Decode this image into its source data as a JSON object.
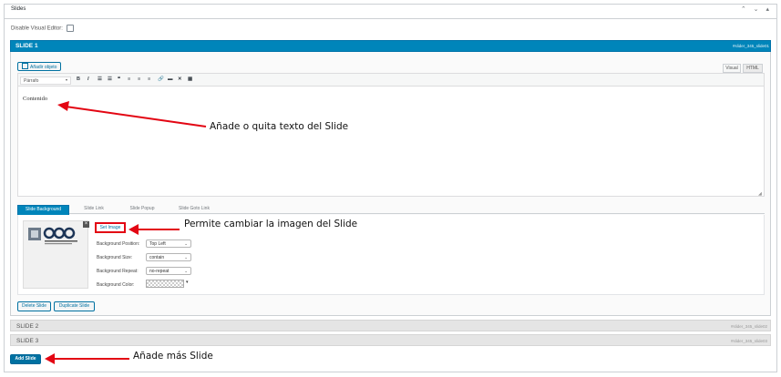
{
  "panel": {
    "title": "Slides",
    "arrows": "⌃ ⌄ ▴"
  },
  "disable_visual_editor": {
    "label": "Disable Visual Editor:"
  },
  "slide1": {
    "title": "SLIDE 1",
    "id": "#slider_345_slide01",
    "media_button": "Añadir objeto",
    "editor_tabs": [
      "Visual",
      "HTML"
    ],
    "format_select": "Párrafo",
    "toolbar_icons": [
      "bold-icon",
      "italic-icon",
      "bullet-list-icon",
      "numbered-list-icon",
      "blockquote-icon",
      "align-left-icon",
      "align-center-icon",
      "align-right-icon",
      "link-icon",
      "more-tag-icon",
      "fullscreen-icon",
      "toolbar-toggle-icon"
    ],
    "content": "Contenido",
    "bg_tabs": [
      "Slide Background",
      "Slide Link",
      "Slide Popup",
      "Slide Goto Link"
    ],
    "set_image": "Set Image",
    "thumbnail_text": "Biblioteca de las Escuelas Universitarias",
    "fields": [
      {
        "label": "Background Position:",
        "value": "Top Left"
      },
      {
        "label": "Background Size:",
        "value": "contain"
      },
      {
        "label": "Background Repeat:",
        "value": "no-repeat"
      }
    ],
    "color_label": "Background Color:",
    "delete_button": "Delete Slide",
    "duplicate_button": "Duplicate Slide"
  },
  "slides_collapsed": [
    {
      "title": "SLIDE 2",
      "id": "#slider_345_slide02"
    },
    {
      "title": "SLIDE 3",
      "id": "#slider_345_slide03"
    }
  ],
  "add_slide_button": "Add Slide",
  "annotations": {
    "text": "Añade o quita texto del Slide",
    "image": "Permite cambiar la imagen del Slide",
    "more": "Añade más Slide"
  },
  "colors": {
    "accent": "#0085ba",
    "annotation": "#e30613"
  }
}
